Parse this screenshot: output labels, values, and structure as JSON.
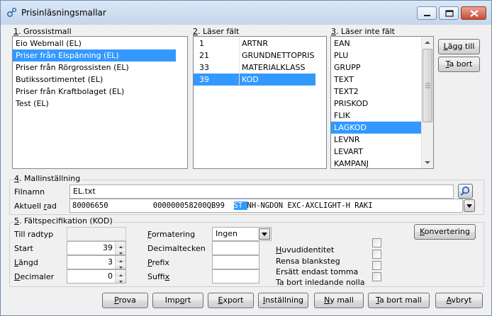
{
  "window": {
    "title": "Prisinläsningsmallar",
    "controls": [
      "minimize-icon",
      "maximize-icon",
      "close-icon"
    ]
  },
  "grossistmall": {
    "label_num": "1",
    "label_text": ". Grossistmall",
    "items": [
      {
        "label": "Eio Webmall (EL)",
        "selected": false
      },
      {
        "label": "Priser från Elspänning (EL)",
        "selected": true
      },
      {
        "label": "Priser från Rörgrossisten (EL)",
        "selected": false
      },
      {
        "label": "Butikssortimentet (EL)",
        "selected": false
      },
      {
        "label": "Priser från Kraftbolaget (EL)",
        "selected": false
      },
      {
        "label": "Test (EL)",
        "selected": false
      }
    ]
  },
  "laser_falt": {
    "label_num": "2",
    "label_text": ". Läser fält",
    "rows": [
      {
        "num": "1",
        "name": "ARTNR",
        "selected": false
      },
      {
        "num": "21",
        "name": "GRUNDNETTOPRIS",
        "selected": false
      },
      {
        "num": "33",
        "name": "MATERIALKLASS",
        "selected": false
      },
      {
        "num": "39",
        "name": "KOD",
        "selected": true
      }
    ]
  },
  "laser_inte_falt": {
    "label_num": "3",
    "label_text": ". Läser inte fält",
    "items": [
      {
        "label": "EAN",
        "selected": false
      },
      {
        "label": "PLU",
        "selected": false
      },
      {
        "label": "GRUPP",
        "selected": false
      },
      {
        "label": "TEXT",
        "selected": false
      },
      {
        "label": "TEXT2",
        "selected": false
      },
      {
        "label": "PRISKOD",
        "selected": false
      },
      {
        "label": "FLIK",
        "selected": false
      },
      {
        "label": "LAGKOD",
        "selected": true
      },
      {
        "label": "LEVNR",
        "selected": false
      },
      {
        "label": "LEVART",
        "selected": false
      },
      {
        "label": "KAMPANJ",
        "selected": false
      }
    ]
  },
  "side_buttons": {
    "add_prefix": "",
    "add_under": "L",
    "add_rest": "ägg till",
    "remove_prefix": "",
    "remove_under": "T",
    "remove_rest": "a bort"
  },
  "mallinstallning": {
    "label_num": "4",
    "label_text": ". Mallinställning",
    "filnamn_label": "Filnamn",
    "filnamn_value": "EL.txt",
    "aktuell_rad_label_prefix": "Aktuell ",
    "aktuell_rad_label_under": "r",
    "aktuell_rad_label_rest": "ad",
    "aktuell_rad_pre": "80006650          000000058200QB99  ",
    "aktuell_rad_hl": "ST ",
    "aktuell_rad_post": "NH-NGDON EXC-AXCLIGHT-H RAKI"
  },
  "faltspec": {
    "label_num": "5",
    "label_text": ". Fältspecifikation (KOD)",
    "till_radtyp_label": "Till radtyp",
    "start_label": "Start",
    "start_value": "39",
    "langd_label_under": "L",
    "langd_label_rest": "ängd",
    "langd_value": "3",
    "decimaler_label_under": "D",
    "decimaler_label_rest": "ecimaler",
    "decimaler_value": "0",
    "formatering_label_under": "F",
    "formatering_label_rest": "ormatering",
    "formatering_value": "Ingen",
    "decimaltecken_label": "Decimaltecken",
    "prefix_label_under": "P",
    "prefix_label_rest": "refix",
    "suffix_label_pre": "Suffi",
    "suffix_label_under": "x",
    "konvertering_label_under": "K",
    "konvertering_label_rest": "onvertering",
    "checkboxes": [
      {
        "pre": "",
        "under": "H",
        "rest": "uvudidentitet",
        "checked": false
      },
      {
        "pre": "Rensa blanksteg",
        "under": "",
        "rest": "",
        "checked": false
      },
      {
        "pre": "Ersätt endast tomma",
        "under": "",
        "rest": "",
        "checked": false
      },
      {
        "pre": "Ta bort inledande nolla",
        "under": "",
        "rest": "",
        "checked": false
      }
    ]
  },
  "bottom_buttons": [
    {
      "name": "prova-button",
      "pre": "",
      "under": "P",
      "rest": "rova"
    },
    {
      "name": "import-button",
      "pre": "Imp",
      "under": "o",
      "rest": "rt"
    },
    {
      "name": "export-button",
      "pre": "",
      "under": "E",
      "rest": "xport"
    },
    {
      "name": "installning-button",
      "pre": "",
      "under": "I",
      "rest": "nställning"
    },
    {
      "name": "ny-mall-button",
      "pre": "",
      "under": "N",
      "rest": "y mall"
    },
    {
      "name": "ta-bort-mall-button",
      "pre": "",
      "under": "T",
      "rest": "a bort mall"
    },
    {
      "name": "avbryt-button",
      "pre": "",
      "under": "A",
      "rest": "vbryt"
    }
  ],
  "colors": {
    "selection": "#3399ff",
    "titlebar": "#c4d6ec",
    "close_button": "#c84b33"
  }
}
